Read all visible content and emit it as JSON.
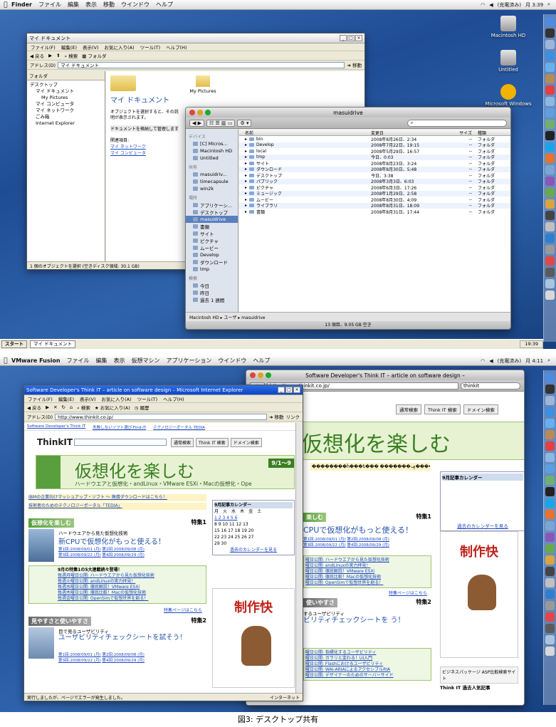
{
  "shot1": {
    "menubar": {
      "app": "Finder",
      "items": [
        "ファイル",
        "編集",
        "表示",
        "移動",
        "ウインドウ",
        "ヘルプ"
      ],
      "status": "(充電済み)",
      "clock": "月 3:39"
    },
    "desktop_icons": [
      "Macintosh HD",
      "Untitled",
      "Microsoft Windows"
    ],
    "xp_window": {
      "title": "マイ ドキュメント",
      "menu": [
        "ファイル(F)",
        "編集(E)",
        "表示(V)",
        "お気に入り(A)",
        "ツール(T)",
        "ヘルプ(H)"
      ],
      "toolbar": [
        "戻る",
        "検索",
        "フォルダ"
      ],
      "address_label": "アドレス(D)",
      "address_value": "マイ ドキュメント",
      "go_label": "移動",
      "folder_pane_label": "フォルダ",
      "tree": [
        "デスクトップ",
        "マイ ドキュメント",
        "My Pictures",
        "マイ コンピュータ",
        "マイ ネットワーク",
        "ごみ箱",
        "Internet Explorer"
      ],
      "heading": "マイ ドキュメント",
      "description": "オブジェクトを選択すると、その説明が表示されます。",
      "description2": "ドキュメントを格納して管理します",
      "related_label": "関連項目:",
      "related_links": [
        "マイ ネットワーク",
        "マイ コンピュータ"
      ],
      "file_item": "My Pictures",
      "status": "1 個のオブジェクトを選択 (空きディスク領域: 30.1 GB)"
    },
    "finder": {
      "title": "masuidrive",
      "sidebar": {
        "devices_header": "デバイス",
        "devices": [
          "[C] Micros...",
          "Macintosh HD",
          "Untitled"
        ],
        "shared_header": "共有",
        "shared": [
          "masuidriv...",
          "timecapsule",
          "win2k"
        ],
        "places_header": "場所",
        "places": [
          "アプリケーシ...",
          "デスクトップ",
          "masuidrive",
          "書類",
          "サイト",
          "ピクチャ",
          "ムービー",
          "Develop",
          "ダウンロード",
          "tmp"
        ],
        "search_header": "検索",
        "search": [
          "今日",
          "昨日",
          "過去 1 週間"
        ]
      },
      "columns": [
        "名前",
        "変更日",
        "サイズ",
        "種類"
      ],
      "rows": [
        {
          "name": "bin",
          "date": "2008年8月26日、2:34",
          "size": "--",
          "kind": "フォルダ"
        },
        {
          "name": "Develop",
          "date": "2008年7月22日、19:15",
          "size": "--",
          "kind": "フォルダ"
        },
        {
          "name": "local",
          "date": "2008年5月29日、16:57",
          "size": "--",
          "kind": "フォルダ"
        },
        {
          "name": "tmp",
          "date": "今日、0:03",
          "size": "--",
          "kind": "フォルダ"
        },
        {
          "name": "サイト",
          "date": "2008年8月23日、3:24",
          "size": "--",
          "kind": "フォルダ"
        },
        {
          "name": "ダウンロード",
          "date": "2008年8月30日、5:48",
          "size": "--",
          "kind": "フォルダ"
        },
        {
          "name": "デスクトップ",
          "date": "今日、3:38",
          "size": "--",
          "kind": "フォルダ"
        },
        {
          "name": "パブリック",
          "date": "2008年3月3日、6:03",
          "size": "--",
          "kind": "フォルダ"
        },
        {
          "name": "ピクチャ",
          "date": "2008年6月3日、17:26",
          "size": "--",
          "kind": "フォルダ"
        },
        {
          "name": "ミュージック",
          "date": "2008年1月29日、2:58",
          "size": "--",
          "kind": "フォルダ"
        },
        {
          "name": "ムービー",
          "date": "2008年8月30日、4:09",
          "size": "--",
          "kind": "フォルダ"
        },
        {
          "name": "ライブラリ",
          "date": "2008年8月31日、18:09",
          "size": "--",
          "kind": "フォルダ"
        },
        {
          "name": "書類",
          "date": "2008年8月31日、17:44",
          "size": "--",
          "kind": "フォルダ"
        }
      ],
      "path": [
        "Macintosh HD",
        "ユーザ",
        "masuidrive"
      ],
      "status": "13 項目、9.05 GB 空き"
    },
    "taskbar": {
      "start": "スタート",
      "task": "マイ ドキュメント",
      "clock": "19:39"
    }
  },
  "shot2": {
    "menubar": {
      "app": "VMware Fusion",
      "items": [
        "ファイル",
        "編集",
        "表示",
        "仮想マシン",
        "アプリケーション",
        "ウインドウ",
        "ヘルプ"
      ],
      "status": "(充電済み)",
      "clock": "月 4:11"
    },
    "ie": {
      "title": "Software Developer's Think IT – article on software design – Microsoft Internet Explorer",
      "menu": [
        "ファイル(F)",
        "編集(E)",
        "表示(V)",
        "お気に入り(A)",
        "ツール(T)",
        "ヘルプ(H)"
      ],
      "toolbar": [
        "戻る",
        "検索",
        "お気に入り(A)",
        "履歴"
      ],
      "address_label": "アドレス(D)",
      "url": "http://www.thinkit.co.jp/",
      "go_label": "移動",
      "links_label": "リンク",
      "bar_links": [
        "Software Developer's Think IT",
        "失敗しないソフト選び Find-IT",
        "テクノロジーポータル TEDIA"
      ],
      "logo": "ThinkIT",
      "search_buttons": [
        "通常検索",
        "Think IT 検索",
        "ドメイン検索"
      ],
      "banner_title": "仮想化を楽しむ",
      "banner_sub": "ハードウエアと仮想化・andLinux・VMware ESXi・Macの仮想化・Ope",
      "banner_badge": "9/1〜9",
      "notice1": "IBMの企業向けマッシュアップ・ソフト 〜 無償ダウンロードはこちら！",
      "notice2": "技術者のためのテクノロジーポータル「TEDIA」",
      "calendar_title": "9月記事カレンダー",
      "calendar_days": [
        "月",
        "火",
        "水",
        "木",
        "金",
        "土"
      ],
      "calendar_rows": [
        "1 2 3 4 5 6",
        "8 9 10 11 12 13",
        "15 16 17 18 19 20",
        "22 23 24 25 26 27",
        "29 30"
      ],
      "calendar_link": "過去のカレンダーを見る",
      "section1_title": "仮想化を楽しむ",
      "section1_tag": "特集1",
      "article1_sub": "ハードウエアから見た仮想化技術",
      "article1_title": "新CPUで仮想化がもっと使える！",
      "article1_parts": [
        "第1回:2008/09/01 (月)",
        "第2回:2008/09/08 (月)",
        "第3回:2008/09/22 (月)",
        "第4回:2008/09/29 (月)"
      ],
      "lineup_head": "9月の特集1の5大連載続々登場！",
      "lineup": [
        "毎週月曜日公開: ハードウエアから見た仮想化技術",
        "毎週火曜日公開: andLinuxの実力拝見！",
        "毎週水曜日公開: 徹底解説！VMware ESXi",
        "毎週木曜日公開: 徹底比較！Macの仮想化技術",
        "毎週金曜日公開: OpenSimで仮想世界を創る！"
      ],
      "feature_link": "特集ページはこちら",
      "section2_title": "見やすさと使いやすさ",
      "section2_tag": "特集2",
      "article2_sub": "目で見るユーザビリティ",
      "article2_title": "ユーザビリティチェックシートを試そう！",
      "article2_parts": [
        "第1回:2008/09/01 (月)",
        "第2回:2008/09/08 (月)",
        "第3回:2008/09/22 (月)",
        "第4回:2008/09/29 (月)"
      ],
      "ad_text": "制作快",
      "status_left": "実行しましたが、ページでエラーが発生しました。",
      "status_right": "インターネット"
    },
    "safari": {
      "title": "Software Developer's Think IT – article on software design –",
      "url": "http://www.thinkit.co.jp/",
      "search": "thinkit",
      "search_buttons": [
        "通常検索",
        "Think IT 検索",
        "ドメイン検索"
      ],
      "banner_title": "仮想化を楽しむ",
      "garbled": "��������ĥ���ե��� �������ݡ����TEDIA",
      "calendar_title": "9月記事カレンダー",
      "calendar_more": "過去のカレンダーを見る",
      "section1_title": "楽しむ",
      "section1_tag": "特集1",
      "article1_title": "CPUで仮想化がもっと使える！",
      "article1_parts": [
        "第1回:2008/09/01 (月)",
        "第2回:2008/09/08 (月)",
        "第3回:2008/09/22 (月)",
        "第4回:2008/09/29 (月)"
      ],
      "lineup": [
        "曜日公開: ハードウエアから見た仮想化技術",
        "曜日公開: andLinuxの実力拝見！",
        "曜日公開: 徹底解説！VMware ESXi",
        "曜日公開: 徹底比較！Macの仮想化技術",
        "曜日公開: OpenSimで仮想世界を創る！"
      ],
      "feature_link": "特集ページはこちら",
      "section2_title": "使いやすさ",
      "section2_tag": "特集2",
      "article2_sub": "するユーザビリティ",
      "article2_title": "ビリティチェックシートを う！",
      "lineup2": [
        "曜日公開: 指標化するユーザビリティ",
        "曜日公開: ガラリと変わる！UI入門",
        "曜日公開: Flashにおけるユーザビリティ",
        "曜日公開: WAI-ARIAによるアクセシブルRIA",
        "曜日公開: デザイナーのためのサーバーサイド"
      ],
      "ad_text": "制作快",
      "promo": "ビジネスパッケージ ASP比較検索サイト",
      "popular": "Think IT 過去人気記事"
    }
  },
  "caption": "図3: デスクトップ共有",
  "colors": {
    "desktop": "#1f4c94",
    "xp_face": "#ece9d8",
    "finder_sidebar": "#dde4ee",
    "banner_green": "#5a9f3d",
    "link_blue": "#1b47c0"
  }
}
